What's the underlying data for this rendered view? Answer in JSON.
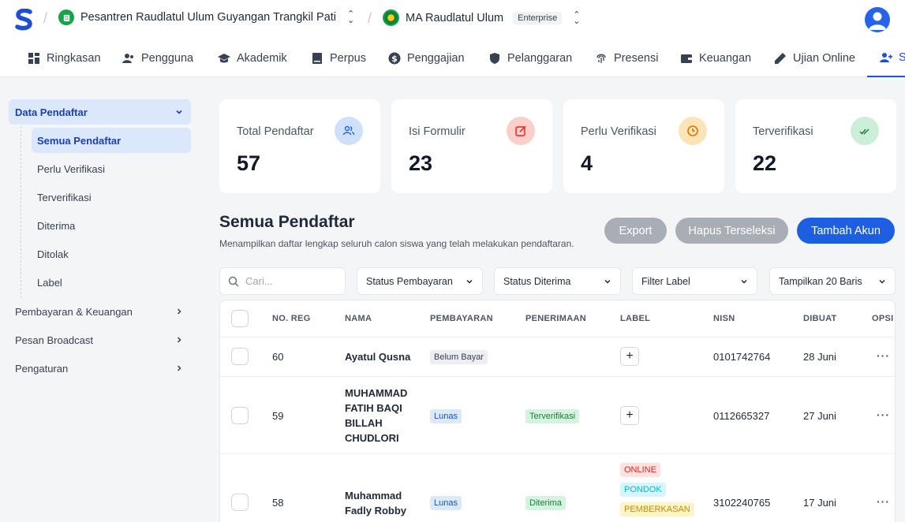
{
  "header": {
    "school_group": "Pesantren Raudlatul Ulum Guyangan Trangkil Pati",
    "school": "MA Raudlatul Ulum",
    "plan_badge": "Enterprise"
  },
  "nav": [
    {
      "label": "Ringkasan",
      "icon": "dashboard-icon"
    },
    {
      "label": "Pengguna",
      "icon": "users-icon"
    },
    {
      "label": "Akademik",
      "icon": "graduation-cap-icon"
    },
    {
      "label": "Perpus",
      "icon": "book-icon"
    },
    {
      "label": "Penggajian",
      "icon": "dollar-icon"
    },
    {
      "label": "Pelanggaran",
      "icon": "shield-icon"
    },
    {
      "label": "Presensi",
      "icon": "fingerprint-icon"
    },
    {
      "label": "Keuangan",
      "icon": "wallet-icon"
    },
    {
      "label": "Ujian Online",
      "icon": "pencil-icon"
    },
    {
      "label": "S",
      "icon": "user-plus-icon"
    }
  ],
  "sidebar": {
    "group": "Data Pendaftar",
    "sub_items": [
      "Semua Pendaftar",
      "Perlu Verifikasi",
      "Terverifikasi",
      "Diterima",
      "Ditolak",
      "Label"
    ],
    "main_items": [
      "Pembayaran & Keuangan",
      "Pesan Broadcast",
      "Pengaturan"
    ]
  },
  "stats": [
    {
      "label": "Total Pendaftar",
      "value": "57",
      "icon": "users-icon",
      "color": "#cfe0fb"
    },
    {
      "label": "Isi Formulir",
      "value": "23",
      "icon": "edit-icon",
      "color": "#fbd0cb"
    },
    {
      "label": "Perlu Verifikasi",
      "value": "4",
      "icon": "clock-icon",
      "color": "#fde4b8"
    },
    {
      "label": "Terverifikasi",
      "value": "22",
      "icon": "double-check-icon",
      "color": "#cdeed8"
    }
  ],
  "section": {
    "title": "Semua Pendaftar",
    "subtitle": "Menampilkan daftar lengkap seluruh calon siswa yang telah melakukan pendaftaran.",
    "export": "Export",
    "delete_selected": "Hapus Terseleksi",
    "add_account": "Tambah Akun"
  },
  "filters": {
    "search_placeholder": "Cari...",
    "payment_status": "Status Pembayaran",
    "accepted_status": "Status Diterima",
    "label_filter": "Filter Label",
    "rows": "Tampilkan 20 Baris"
  },
  "table": {
    "headers": [
      "NO. REG",
      "NAMA",
      "PEMBAYARAN",
      "PENERIMAAN",
      "LABEL",
      "NISN",
      "DIBUAT",
      "OPSI"
    ],
    "rows": [
      {
        "reg": "60",
        "name": "Ayatul Qusna",
        "payment": "Belum Bayar",
        "acceptance": "",
        "labels": [],
        "nisn": "0101742764",
        "created": "28 Juni"
      },
      {
        "reg": "59",
        "name": "MUHAMMAD FATIH BAQI BILLAH CHUDLORI",
        "payment": "Lunas",
        "acceptance": "Terverifikasi",
        "labels": [],
        "nisn": "0112665327",
        "created": "27 Juni"
      },
      {
        "reg": "58",
        "name": "Muhammad Fadly Robby",
        "payment": "Lunas",
        "acceptance": "Diterima",
        "labels": [
          "ONLINE",
          "PONDOK",
          "PEMBERKASAN"
        ],
        "nisn": "3102240765",
        "created": "17 Juni"
      }
    ]
  }
}
